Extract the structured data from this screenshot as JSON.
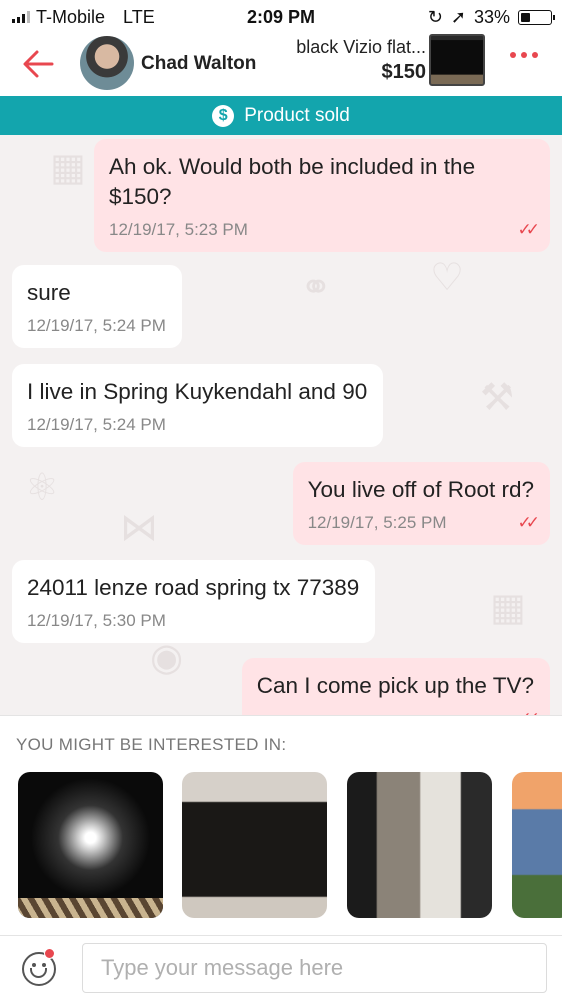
{
  "status_bar": {
    "carrier": "T-Mobile",
    "network": "LTE",
    "time": "2:09 PM",
    "battery": "33%",
    "battery_level": 0.33
  },
  "header": {
    "seller_name": "Chad Walton",
    "product_title": "black Vizio flat...",
    "product_price": "$150",
    "back_icon": "arrow-left-icon",
    "more_icon": "more-dots-icon"
  },
  "banner": {
    "label": "Product sold",
    "icon": "dollar-icon"
  },
  "messages": [
    {
      "side": "me",
      "text": "Ah ok. Would both be included in the $150?",
      "time": "12/19/17, 5:23 PM",
      "read": true
    },
    {
      "side": "them",
      "text": "sure",
      "time": "12/19/17, 5:24 PM"
    },
    {
      "side": "them",
      "text": "I live in Spring Kuykendahl and 90",
      "time": "12/19/17, 5:24 PM"
    },
    {
      "side": "me",
      "text": "You live off of Root rd?",
      "time": "12/19/17, 5:25 PM",
      "read": true
    },
    {
      "side": "them",
      "text": "24011 lenze road spring tx 77389",
      "time": "12/19/17, 5:30 PM"
    },
    {
      "side": "me",
      "text": "Can I come pick up the TV?",
      "time": "",
      "read": true
    }
  ],
  "suggestions": {
    "label": "YOU MIGHT BE INTERESTED IN:",
    "items": [
      "tv-monitor-image",
      "tv-stand-image",
      "entertainment-center-image",
      "outdoor-photo-image"
    ]
  },
  "input": {
    "placeholder": "Type your message here",
    "value": ""
  },
  "colors": {
    "accent": "#e8474f",
    "banner": "#13a5ad",
    "my_bubble": "#ffe3e6",
    "their_bubble": "#ffffff"
  }
}
